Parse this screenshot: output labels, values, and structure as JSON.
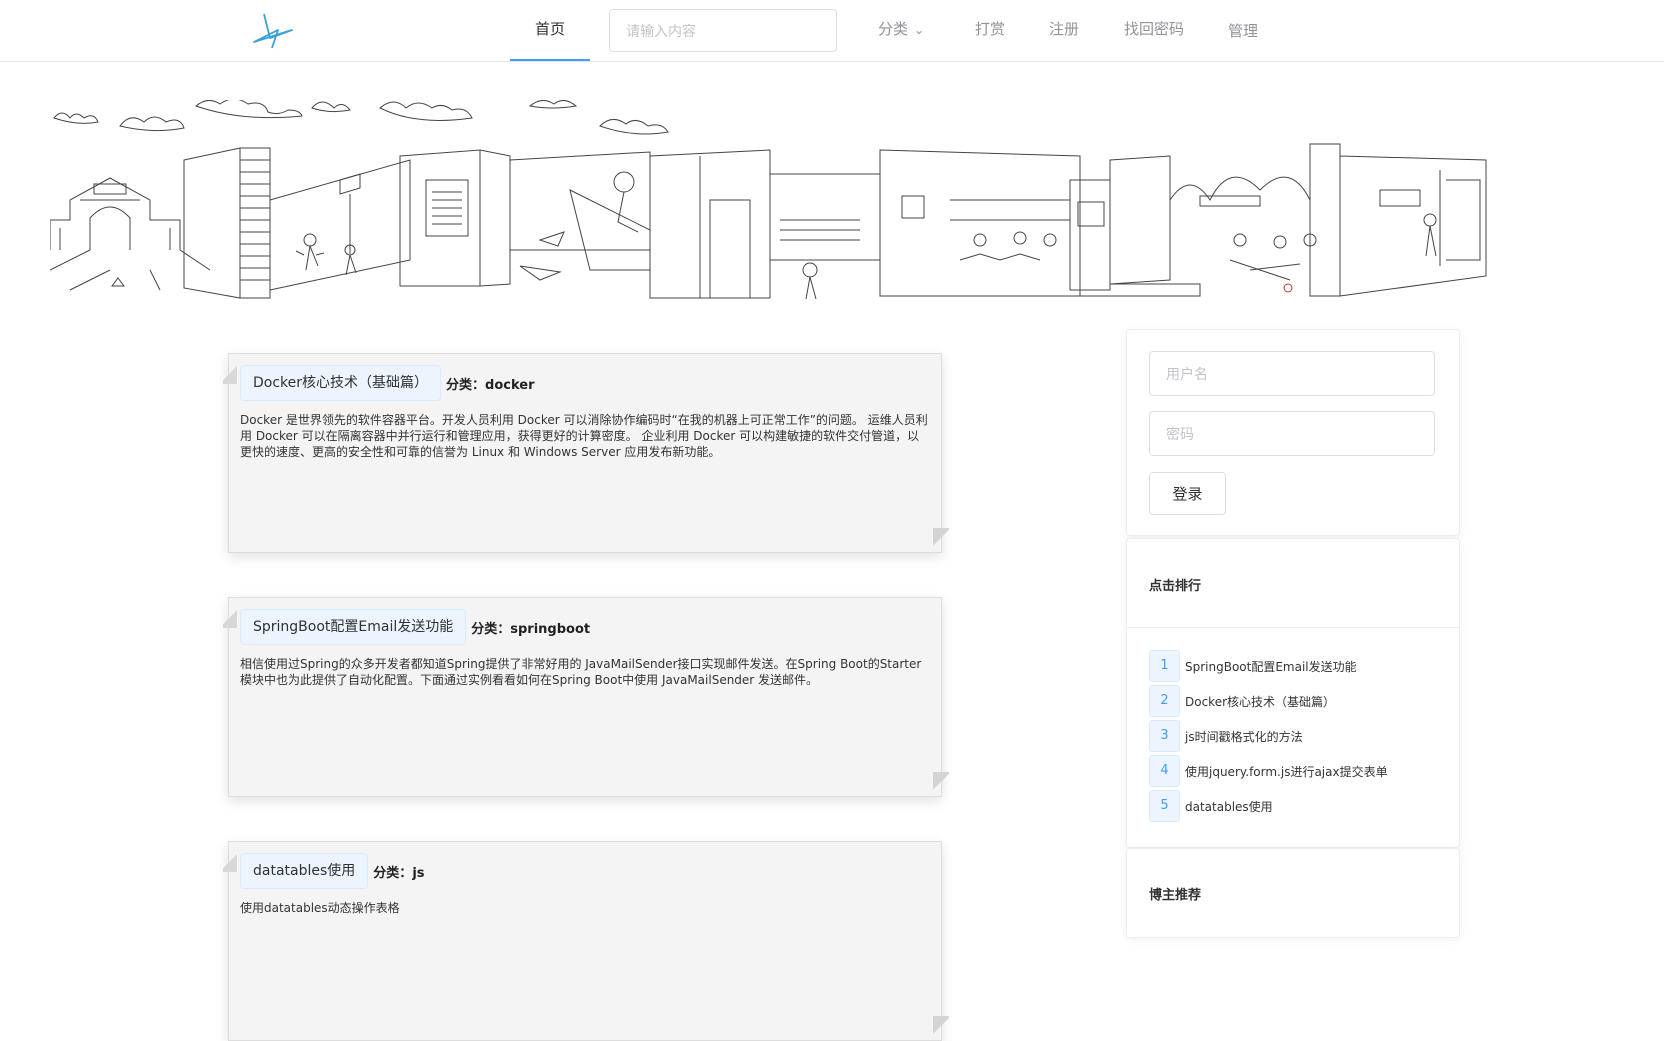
{
  "header": {
    "nav": {
      "home": "首页",
      "category": "分类",
      "reward": "打赏",
      "register": "注册",
      "recover_password": "找回密码",
      "admin": "管理"
    },
    "search": {
      "placeholder": "请输入内容",
      "value": ""
    },
    "colors": {
      "accent": "#409eff",
      "nav_text": "#909399"
    }
  },
  "articles": [
    {
      "title": "Docker核心技术（基础篇）",
      "category_label": "分类：",
      "category": "docker",
      "summary": "Docker 是世界领先的软件容器平台。开发人员利用 Docker 可以消除协作编码时“在我的机器上可正常工作”的问题。 运维人员利用 Docker 可以在隔离容器中并行运行和管理应用，获得更好的计算密度。 企业利用 Docker 可以构建敏捷的软件交付管道，以更快的速度、更高的安全性和可靠的信誉为 Linux 和 Windows Server 应用发布新功能。"
    },
    {
      "title": "SpringBoot配置Email发送功能",
      "category_label": "分类：",
      "category": "springboot",
      "summary": "相信使用过Spring的众多开发者都知道Spring提供了非常好用的 JavaMailSender接口实现邮件发送。在Spring Boot的Starter模块中也为此提供了自动化配置。下面通过实例看看如何在Spring Boot中使用 JavaMailSender 发送邮件。"
    },
    {
      "title": "datatables使用",
      "category_label": "分类：",
      "category": "js",
      "summary": "使用datatables动态操作表格"
    }
  ],
  "login": {
    "username_placeholder": "用户名",
    "password_placeholder": "密码",
    "login_button": "登录"
  },
  "ranking": {
    "title": "点击排行",
    "items": [
      {
        "rank": "1",
        "title": "SpringBoot配置Email发送功能"
      },
      {
        "rank": "2",
        "title": "Docker核心技术（基础篇）"
      },
      {
        "rank": "3",
        "title": "js时间戳格式化的方法"
      },
      {
        "rank": "4",
        "title": "使用jquery.form.js进行ajax提交表单"
      },
      {
        "rank": "5",
        "title": "datatables使用"
      }
    ]
  },
  "recommend": {
    "title": "博主推荐"
  }
}
